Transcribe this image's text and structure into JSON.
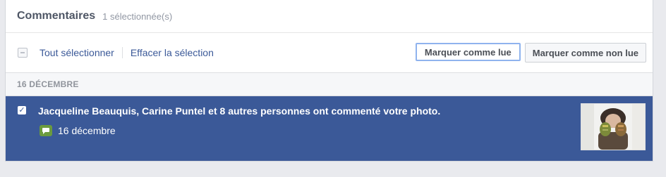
{
  "header": {
    "title": "Commentaires",
    "selected_count": "1 sélectionnée(s)"
  },
  "toolbar": {
    "select_all": "Tout sélectionner",
    "clear_selection": "Effacer la sélection",
    "mark_read": "Marquer comme lue",
    "mark_unread": "Marquer comme non lue"
  },
  "group": {
    "date_label": "16 DÉCEMBRE"
  },
  "notification": {
    "text": "Jacqueline Beauquis, Carine Puntel et 8 autres personnes ont commenté votre photo.",
    "date": "16 décembre",
    "icon": "comment-icon",
    "selected": true
  },
  "colors": {
    "accent": "#3b5998",
    "comment_icon": "#6b9b3e",
    "page_bg": "#e9eaee"
  }
}
